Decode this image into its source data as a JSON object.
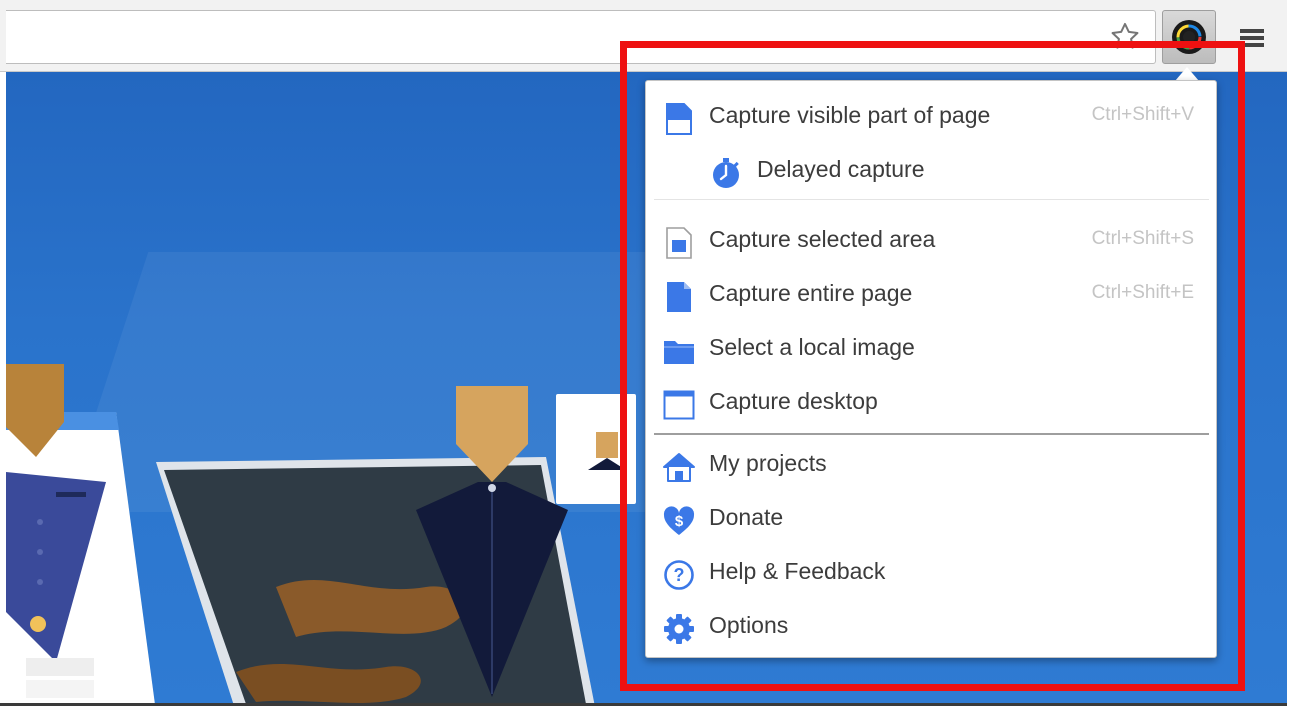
{
  "menu": {
    "items": [
      {
        "label": "Capture visible part of page",
        "shortcut": "Ctrl+Shift+V",
        "icon": "visible-page-icon"
      },
      {
        "label": "Delayed capture",
        "shortcut": "",
        "icon": "timer-icon"
      },
      {
        "label": "Capture selected area",
        "shortcut": "Ctrl+Shift+S",
        "icon": "selected-area-icon"
      },
      {
        "label": "Capture entire page",
        "shortcut": "Ctrl+Shift+E",
        "icon": "entire-page-icon"
      },
      {
        "label": "Select a local image",
        "shortcut": "",
        "icon": "folder-icon"
      },
      {
        "label": "Capture desktop",
        "shortcut": "",
        "icon": "desktop-window-icon"
      },
      {
        "label": "My projects",
        "shortcut": "",
        "icon": "home-icon"
      },
      {
        "label": "Donate",
        "shortcut": "",
        "icon": "heart-dollar-icon"
      },
      {
        "label": "Help & Feedback",
        "shortcut": "",
        "icon": "help-icon"
      },
      {
        "label": "Options",
        "shortcut": "",
        "icon": "gear-icon"
      }
    ]
  },
  "colors": {
    "accent": "#3b78e7",
    "highlight": "#ee1111",
    "page_background": "#2a73cb",
    "shortcut_text": "#c4c4c4"
  },
  "toolbar": {
    "icons": [
      "bookmark-star-icon",
      "screenshot-extension-icon",
      "hamburger-menu-icon"
    ]
  }
}
